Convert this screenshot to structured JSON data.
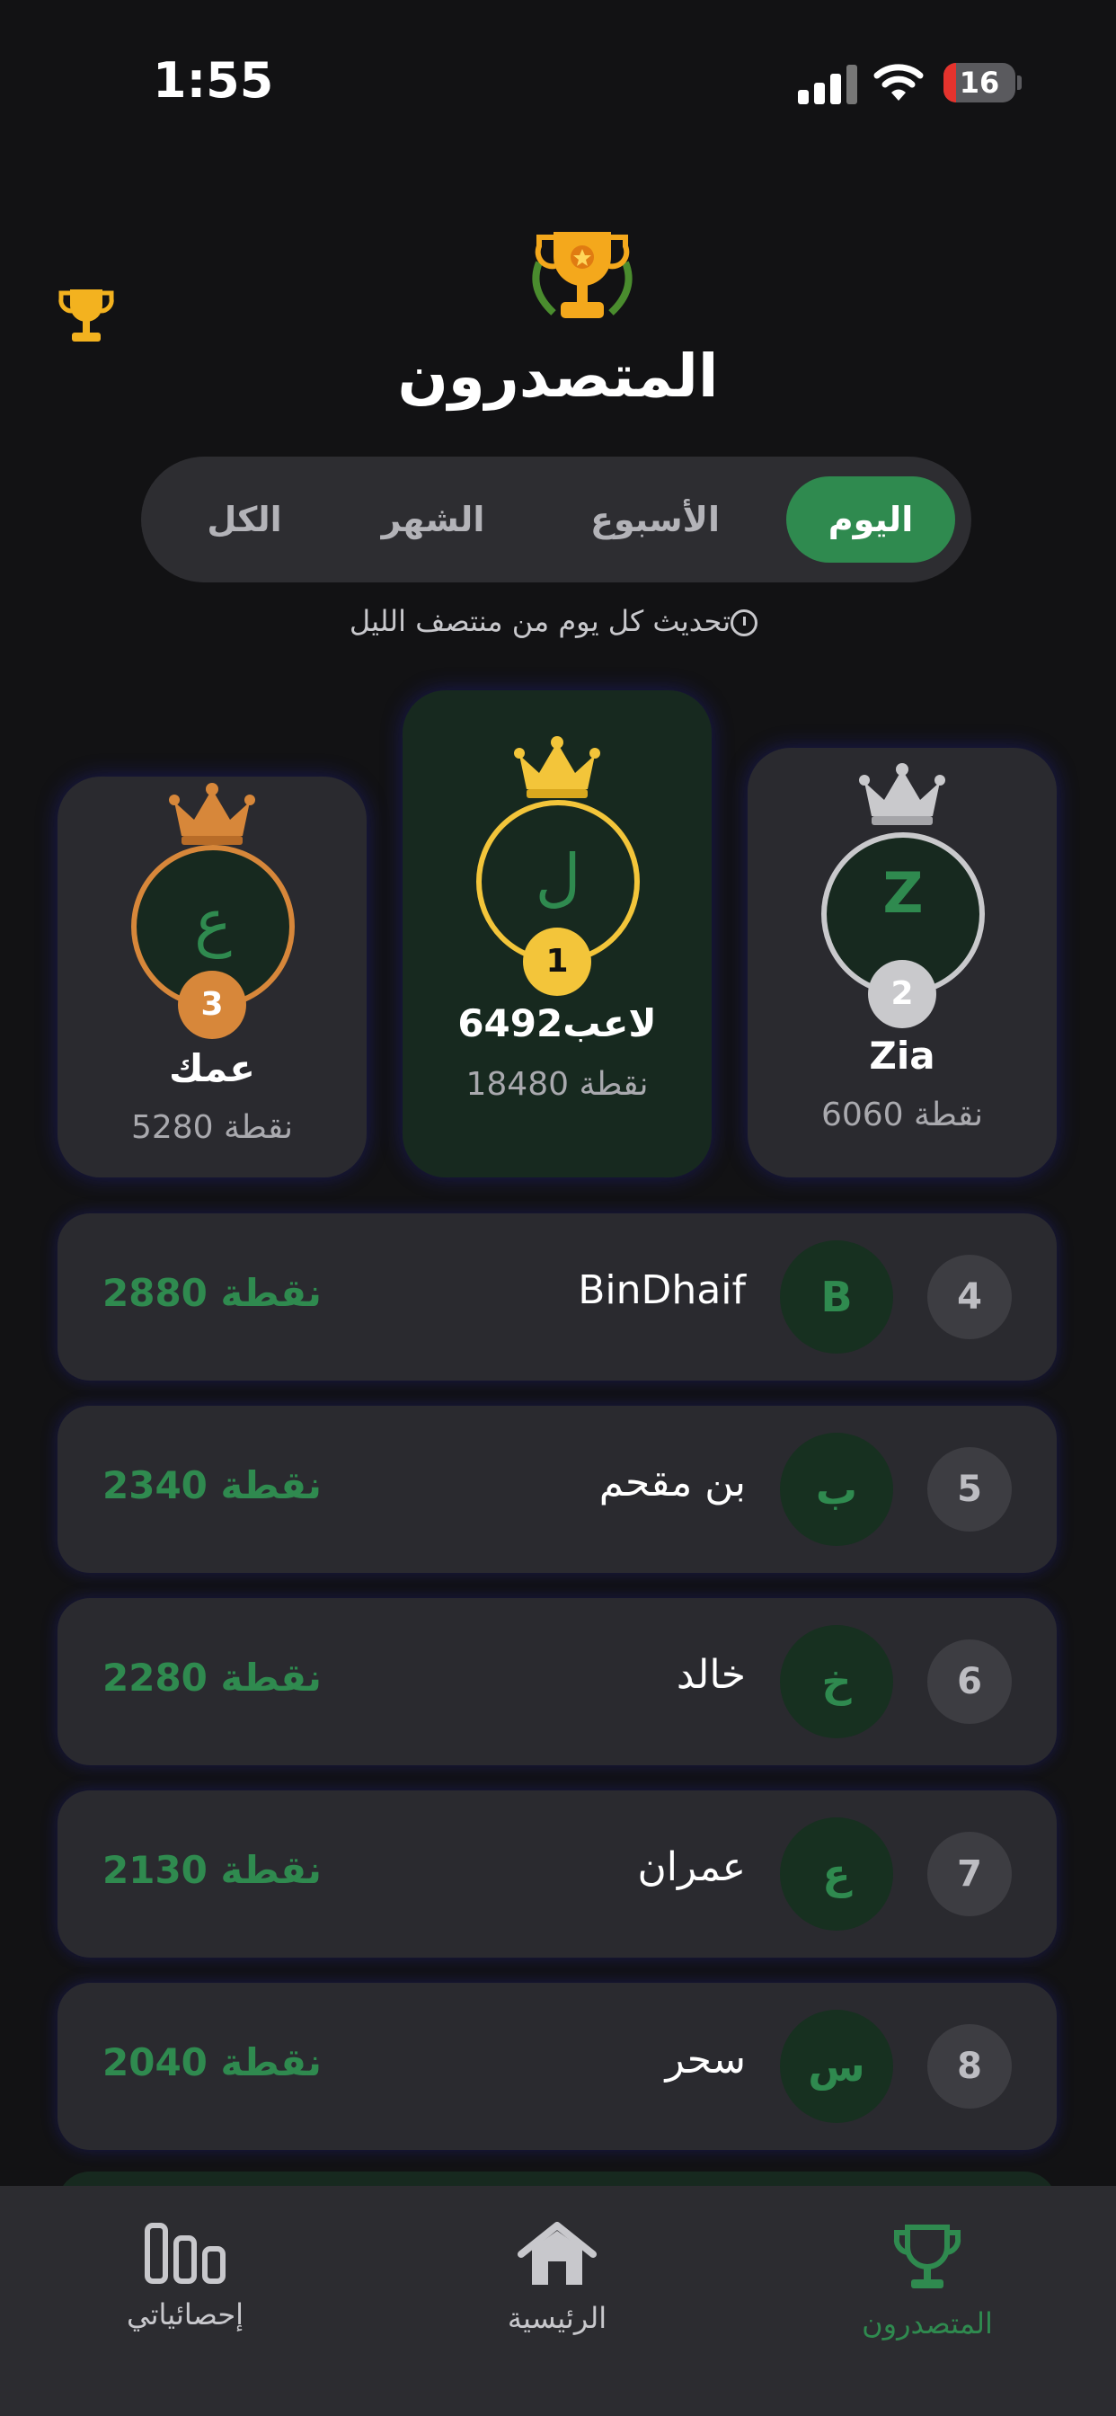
{
  "status_bar": {
    "time": "1:55",
    "battery": "16"
  },
  "header": {
    "title": "المتصدرون"
  },
  "tabs": [
    {
      "label": "الكل"
    },
    {
      "label": "الشهر"
    },
    {
      "label": "الأسبوع"
    },
    {
      "label": "اليوم",
      "active": true
    }
  ],
  "refresh_note": "تحديث كل يوم من منتصف الليل",
  "podium": {
    "first": {
      "rank": "1",
      "initial": "ل",
      "name": "لاعب6492",
      "points": "18480 نقطة"
    },
    "second": {
      "rank": "2",
      "initial": "Z",
      "name": "Zia",
      "points": "6060 نقطة"
    },
    "third": {
      "rank": "3",
      "initial": "ع",
      "name": "عمك",
      "points": "5280 نقطة"
    }
  },
  "leaderboard": [
    {
      "rank": "4",
      "initial": "B",
      "name": "BinDhaif",
      "points": "2880 نقطة"
    },
    {
      "rank": "5",
      "initial": "ب",
      "name": "بن مقحم",
      "points": "2340 نقطة"
    },
    {
      "rank": "6",
      "initial": "خ",
      "name": "خالد",
      "points": "2280 نقطة"
    },
    {
      "rank": "7",
      "initial": "ع",
      "name": "عمران",
      "points": "2130 نقطة"
    },
    {
      "rank": "8",
      "initial": "س",
      "name": "سحر",
      "points": "2040 نقطة"
    }
  ],
  "bottom_nav": [
    {
      "label": "إحصائياتي",
      "icon": "stats-icon"
    },
    {
      "label": "الرئيسية",
      "icon": "home-icon"
    },
    {
      "label": "المتصدرون",
      "icon": "trophy-icon",
      "active": true
    }
  ],
  "colors": {
    "accent": "#2f8a4f",
    "gold": "#f3c53a",
    "silver": "#c9c9cc",
    "bronze": "#d7873a",
    "background": "#121214"
  }
}
